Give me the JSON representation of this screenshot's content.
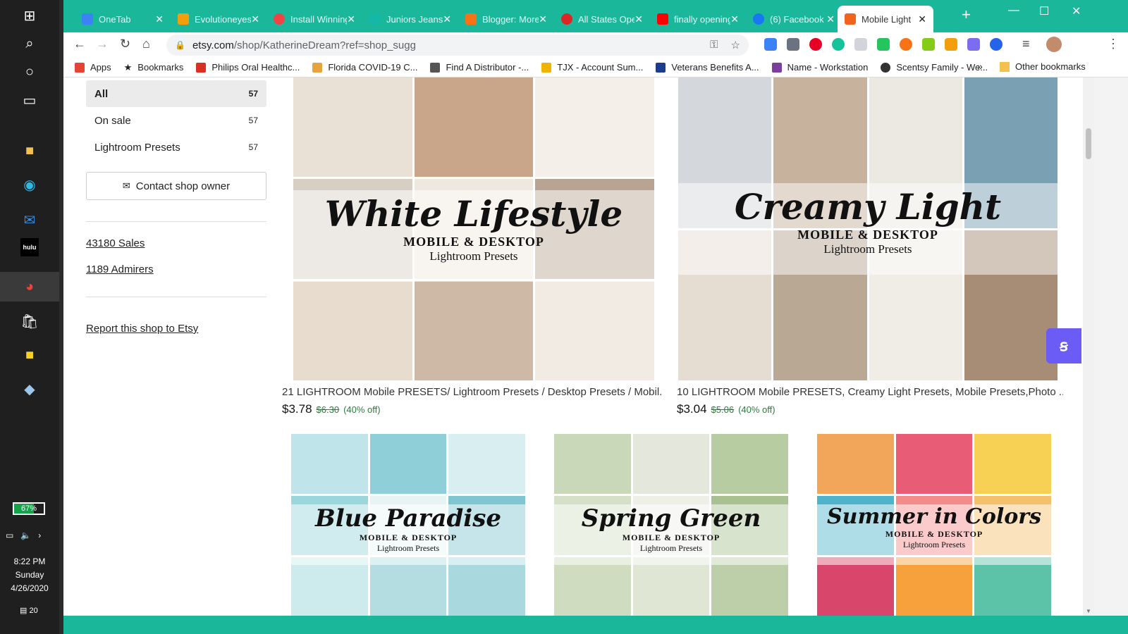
{
  "taskbar": {
    "battery_percent": 67,
    "battery_label": "67%",
    "time": "8:22 PM",
    "day": "Sunday",
    "date": "4/26/2020",
    "notifications": "20"
  },
  "browser": {
    "tabs": [
      {
        "title": "OneTab",
        "color": "#3b82f6"
      },
      {
        "title": "Evolutioneyes",
        "color": "#f59e0b"
      },
      {
        "title": "Install Winning",
        "color": "#ef4444"
      },
      {
        "title": "Juniors Jeans",
        "color": "#14b8a6"
      },
      {
        "title": "Blogger: More",
        "color": "#f97316"
      },
      {
        "title": "All States Open",
        "color": "#dc2626"
      },
      {
        "title": "finally opening",
        "color": "#ff0000"
      },
      {
        "title": "(6) Facebook",
        "color": "#1877f2"
      },
      {
        "title": "Mobile Light",
        "color": "#f1641e"
      }
    ],
    "url_host": "etsy.com",
    "url_path": "/shop/KatherineDream?ref=shop_sugg",
    "bookmarks": [
      {
        "label": "Apps",
        "color": "#e94235"
      },
      {
        "label": "Bookmarks",
        "color": "#333333"
      },
      {
        "label": "Philips Oral Healthc...",
        "color": "#d93025"
      },
      {
        "label": "Florida COVID-19 C...",
        "color": "#e8a33d"
      },
      {
        "label": "Find A Distributor -...",
        "color": "#555555"
      },
      {
        "label": "TJX - Account Sum...",
        "color": "#f0b400"
      },
      {
        "label": "Veterans Benefits A...",
        "color": "#1a3d8f"
      },
      {
        "label": "Name - Workstation",
        "color": "#7b3fa0"
      },
      {
        "label": "Scentsy Family - We...",
        "color": "#333333"
      }
    ],
    "bookmarks_more": "»",
    "other_bookmarks": "Other bookmarks"
  },
  "sidebar": {
    "items": [
      {
        "label": "All",
        "count": "57"
      },
      {
        "label": "On sale",
        "count": "57"
      },
      {
        "label": "Lightroom Presets",
        "count": "57"
      }
    ],
    "contact_label": "Contact shop owner",
    "sales": "43180 Sales",
    "admirers": "1189 Admirers",
    "report": "Report this shop to Etsy"
  },
  "listings": [
    {
      "banner_title": "White Lifestyle",
      "banner_sub1": "MOBILE & DESKTOP",
      "banner_sub2": "Lightroom Presets",
      "title": "21 LIGHTROOM Mobile PRESETS/ Lightroom Presets / Desktop Presets / Mobil...",
      "price": "$3.78",
      "original_price": "$6.30",
      "discount": "(40% off)",
      "palette": [
        "#e9e1d6",
        "#c9a58a",
        "#f4efe9",
        "#d8cfc4",
        "#efe8df",
        "#b9a493",
        "#e7dccd",
        "#cdb9a6",
        "#f1ebe3"
      ]
    },
    {
      "banner_title": "Creamy Light",
      "banner_sub1": "MOBILE & DESKTOP",
      "banner_sub2": "Lightroom Presets",
      "title": "10 LIGHTROOM Mobile PRESETS, Creamy Light Presets, Mobile Presets,Photo ...",
      "price": "$3.04",
      "original_price": "$5.06",
      "discount": "(40% off)",
      "palette": [
        "#d4d8dc",
        "#c7b29e",
        "#ece8e2",
        "#7aa0b4",
        "#e6ddd2",
        "#b9a894",
        "#f0ece6",
        "#a78d76",
        "#dcd3c7"
      ]
    },
    {
      "banner_title": "Blue Paradise",
      "banner_sub1": "MOBILE & DESKTOP",
      "banner_sub2": "Lightroom Presets",
      "palette": [
        "#bfe4ea",
        "#8fd0d8",
        "#d9eef0",
        "#9ad6dc",
        "#e8f4f4",
        "#7fc6d0",
        "#cdeaec",
        "#b4dde2",
        "#a9d9df"
      ]
    },
    {
      "banner_title": "Spring Green",
      "banner_sub1": "MOBILE & DESKTOP",
      "banner_sub2": "Lightroom Presets",
      "palette": [
        "#c9d8b8",
        "#e4e8dc",
        "#b7cca0",
        "#d6e0c8",
        "#eef0e8",
        "#a9c190",
        "#cfdcc0",
        "#dfe6d4",
        "#bccfa8"
      ]
    },
    {
      "banner_title": "Summer in Colors",
      "banner_sub1": "MOBILE & DESKTOP",
      "banner_sub2": "Lightroom Presets",
      "palette": [
        "#f2a65a",
        "#e85d75",
        "#f7d154",
        "#4fb3c9",
        "#f58a8a",
        "#f4c06a",
        "#d9466b",
        "#f7a13c",
        "#5cc2a8"
      ]
    }
  ]
}
